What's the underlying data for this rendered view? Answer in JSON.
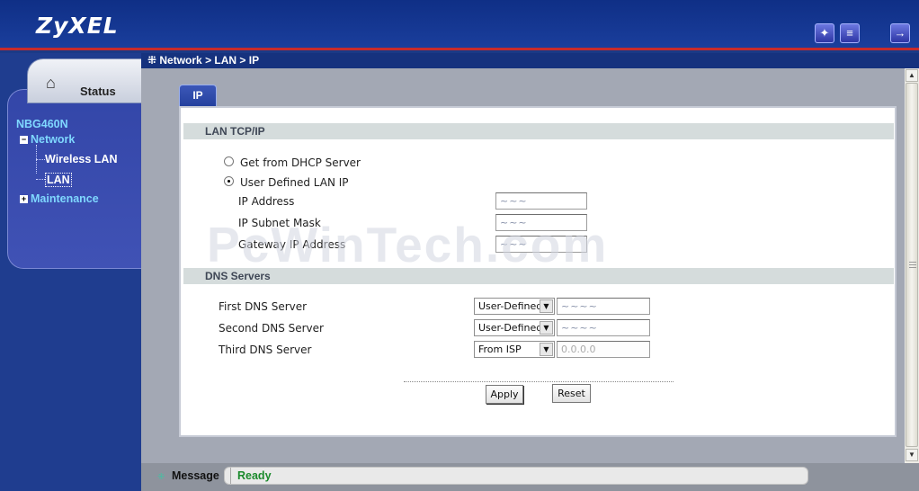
{
  "brand": {
    "logo": "ZyXEL"
  },
  "header": {
    "icons": [
      "wizard-icon",
      "document-icon",
      "logout-icon"
    ]
  },
  "sidebar": {
    "status_tab": "Status",
    "device": "NBG460N",
    "items": [
      {
        "label": "Network",
        "expander": "−"
      },
      {
        "label": "Wireless LAN"
      },
      {
        "label": "LAN"
      },
      {
        "label": "Maintenance",
        "expander": "+"
      }
    ]
  },
  "breadcrumb": "Network > LAN > IP",
  "tab": {
    "label": "IP"
  },
  "lan_section": {
    "title": "LAN TCP/IP",
    "radio_dhcp": "Get from DHCP Server",
    "radio_user": "User Defined LAN IP",
    "ip_address_label": "IP Address",
    "subnet_label": "IP Subnet Mask",
    "gateway_label": "Gateway IP Address",
    "ip_address_value": "~~~",
    "subnet_value": "~~~",
    "gateway_value": "~~~"
  },
  "dns_section": {
    "title": "DNS Servers",
    "rows": [
      {
        "label": "First DNS Server",
        "mode": "User-Defined",
        "value": "~~~~"
      },
      {
        "label": "Second DNS Server",
        "mode": "User-Defined",
        "value": "~~~~"
      },
      {
        "label": "Third DNS Server",
        "mode": "From ISP",
        "value": "0.0.0.0"
      }
    ]
  },
  "buttons": {
    "apply": "Apply",
    "reset": "Reset"
  },
  "watermark": "PcWinTech.com",
  "message": {
    "label": "Message",
    "status": "Ready"
  },
  "colors": {
    "header_blue": "#1a3e9c",
    "accent_red": "#c62b2b",
    "nav_cyan": "#7fd8ff",
    "ready_green": "#1b8a2c"
  }
}
